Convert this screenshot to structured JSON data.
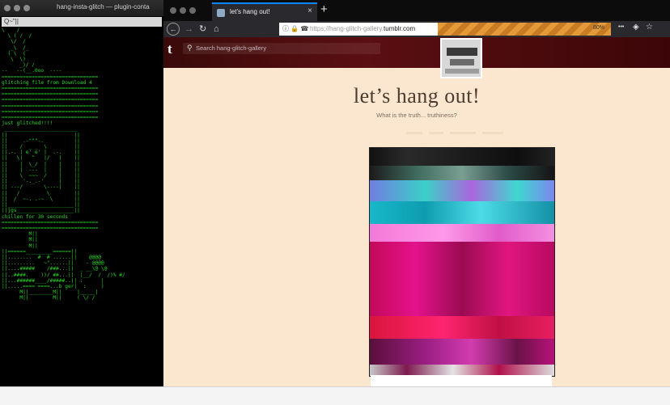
{
  "terminal": {
    "title": "hang-insta-glitch — plugin-conta",
    "search_value": "Q~\"||",
    "output": "\\    /\n  \\ ( /  /\n   \\/  /\n   _\\  /_\n  ( \\  (\n   \\  \\)\n      _)/ /\n--   --(__.0oo  ----\n================================\nglitching file from Download 4\n================================\n================================\n================================\n================================\n================================\n================================\njust glitched!!!!\n ________________________\n||                      ||\n||     .-\"\"\"-.          ||\n||    /  _ _  \\         ||\n||.-. | e' e' |  .-.    ||\n||   \\|   ^   |/   |    ||\n||    |  \\_/  |    |    ||\n||    |  ---  |    |    ||\n||    \\  ~~~  /    |    ||\n||     '-._.-'     |    ||\n|| ---/       \\----|    ||\n||   /         \\        ||\n||  /  ~-. .-~  \\       ||\n||______________________||\n||jgs___________________||\nchillen for 30 seconds\n================================\n================================\n         M||\n         M||\n         M||\n||======_________======||\n||........  #  # ......||    @@@@\n||.........   ~\"......||    - @@@@\n||....#####    /###...||  _ __\\@ \\@\n||..####.    ))/ ##...||  |__/  /  /)% #/\n||...######____/#####..|| :      |\n||.....==== ====...b ger|  :     )\n      M||________M||     |_____|\n      M||        M||     ( \\/ /"
  },
  "browser": {
    "tab_title": "let's hang out!",
    "url_prefix": "https://hang-glitch-gallery.",
    "url_domain": "tumblr.com",
    "zoom": "80%",
    "nav": {
      "back": "←",
      "forward": "→",
      "reload": "↻",
      "home": "⌂",
      "more": "•••",
      "pocket": "◈",
      "star": "☆"
    },
    "url_security": "ⓘ 🔒 ☎",
    "new_tab": "+",
    "close_tab": "×"
  },
  "tumblr": {
    "logo": "t",
    "search_placeholder": "Search hang-glitch-gallery",
    "blog_title": "let’s hang out!",
    "blog_description": "What is the truth... truthiness?"
  },
  "colors": {
    "terminal_text": "#28d628",
    "page_background": "#fbe7cf",
    "header_background": "#4a0b0e",
    "url_stripes": "#e59a3a"
  }
}
